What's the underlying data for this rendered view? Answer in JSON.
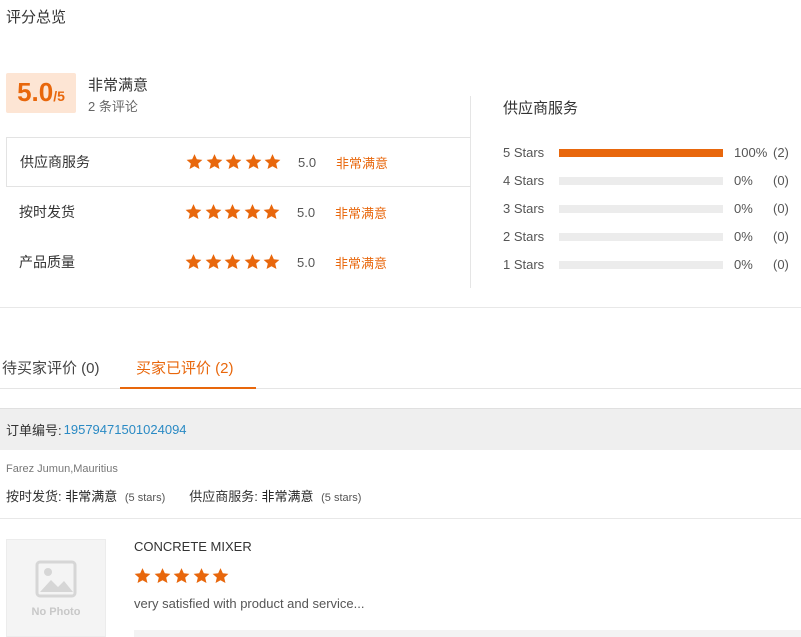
{
  "page_title": "评分总览",
  "overall": {
    "score": "5.0",
    "suffix": "/5",
    "label": "非常满意",
    "count": "2 条评论",
    "score_value": 5
  },
  "ratings": [
    {
      "label": "供应商服务",
      "score": "5.0",
      "text": "非常满意",
      "stars": 5
    },
    {
      "label": "按时发货",
      "score": "5.0",
      "text": "非常满意",
      "stars": 5
    },
    {
      "label": "产品质量",
      "score": "5.0",
      "text": "非常满意",
      "stars": 5
    }
  ],
  "distribution": {
    "title": "供应商服务",
    "rows": [
      {
        "label": "5 Stars",
        "pct": "100%",
        "count": "(2)",
        "fill": 1.0
      },
      {
        "label": "4 Stars",
        "pct": "0%",
        "count": "(0)",
        "fill": 0
      },
      {
        "label": "3 Stars",
        "pct": "0%",
        "count": "(0)",
        "fill": 0
      },
      {
        "label": "2 Stars",
        "pct": "0%",
        "count": "(0)",
        "fill": 0
      },
      {
        "label": "1 Stars",
        "pct": "0%",
        "count": "(0)",
        "fill": 0
      }
    ]
  },
  "tabs": [
    {
      "label": "待买家评价 (0)",
      "active": false
    },
    {
      "label": "买家已评价 (2)",
      "active": true
    }
  ],
  "order": {
    "label": "订单编号:",
    "number": "19579471501024094"
  },
  "review": {
    "buyer": "Farez Jumun,Mauritius",
    "sub_ratings": [
      {
        "label": "按时发货:",
        "value": "非常满意",
        "note": "(5 stars)"
      },
      {
        "label": "供应商服务:",
        "value": "非常满意",
        "note": "(5 stars)"
      }
    ],
    "photo_label": "No Photo",
    "product": "CONCRETE MIXER",
    "stars": 5,
    "text": "very satisfied with product and service..."
  },
  "colors": {
    "accent": "#e8670c",
    "score_bg": "#fde5d4",
    "link": "#2a8ac4"
  }
}
